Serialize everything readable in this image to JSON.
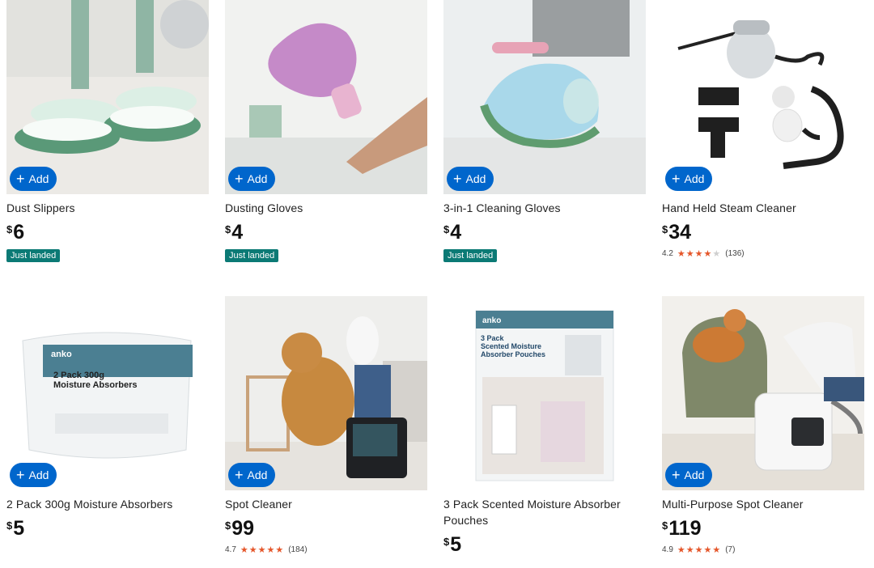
{
  "add_label": "Add",
  "currency": "$",
  "products": [
    {
      "title": "Dust Slippers",
      "price": "6",
      "badge": "Just landed"
    },
    {
      "title": "Dusting Gloves",
      "price": "4",
      "badge": "Just landed"
    },
    {
      "title": "3-in-1 Cleaning Gloves",
      "price": "4",
      "badge": "Just landed"
    },
    {
      "title": "Hand Held Steam Cleaner",
      "price": "34",
      "rating": "4.2",
      "stars": 4,
      "reviews": "(136)"
    },
    {
      "title": "2 Pack 300g Moisture Absorbers",
      "price": "5",
      "image_text": {
        "brand": "anko",
        "line1": "2 Pack 300g",
        "line2": "Moisture Absorbers"
      }
    },
    {
      "title": "Spot Cleaner",
      "price": "99",
      "rating": "4.7",
      "stars": 5,
      "reviews": "(184)"
    },
    {
      "title": "3 Pack Scented Moisture Absorber Pouches",
      "price": "5",
      "image_text": {
        "brand": "anko",
        "line1": "3 Pack",
        "line2": "Scented Moisture",
        "line3": "Absorber Pouches"
      }
    },
    {
      "title": "Multi-Purpose Spot Cleaner",
      "price": "119",
      "rating": "4.9",
      "stars": 5,
      "reviews": "(7)"
    }
  ],
  "colors": {
    "add_button": "#0066cc",
    "badge": "#0b7a75",
    "star": "#e5562a"
  }
}
